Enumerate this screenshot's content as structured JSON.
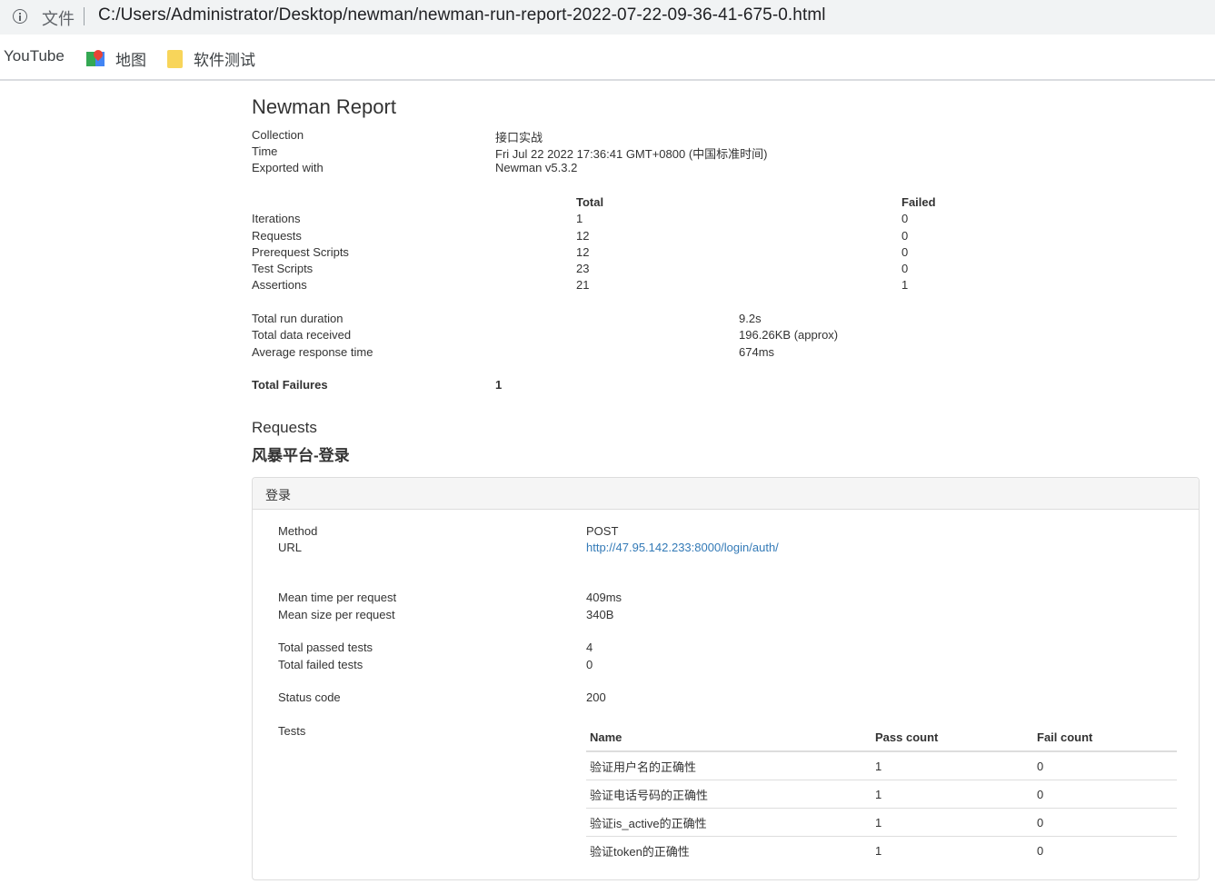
{
  "browser": {
    "protocol_label": "文件",
    "url": "C:/Users/Administrator/Desktop/newman/newman-run-report-2022-07-22-09-36-41-675-0.html",
    "bookmarks": [
      {
        "label": "YouTube"
      },
      {
        "label": "地图"
      },
      {
        "label": "软件测试"
      }
    ]
  },
  "report": {
    "title": "Newman Report",
    "meta": [
      {
        "label": "Collection",
        "value": "接口实战"
      },
      {
        "label": "Time",
        "value": "Fri Jul 22 2022 17:36:41 GMT+0800 (中国标准时间)"
      },
      {
        "label": "Exported with",
        "value": "Newman v5.3.2"
      }
    ],
    "summary_headers": {
      "total": "Total",
      "failed": "Failed"
    },
    "summary": [
      {
        "label": "Iterations",
        "total": "1",
        "failed": "0"
      },
      {
        "label": "Requests",
        "total": "12",
        "failed": "0"
      },
      {
        "label": "Prerequest Scripts",
        "total": "12",
        "failed": "0"
      },
      {
        "label": "Test Scripts",
        "total": "23",
        "failed": "0"
      },
      {
        "label": "Assertions",
        "total": "21",
        "failed": "1"
      }
    ],
    "timings": [
      {
        "label": "Total run duration",
        "value": "9.2s"
      },
      {
        "label": "Total data received",
        "value": "196.26KB (approx)"
      },
      {
        "label": "Average response time",
        "value": "674ms"
      }
    ],
    "total_failures": {
      "label": "Total Failures",
      "value": "1"
    },
    "requests_heading": "Requests",
    "folder_name": "风暴平台-登录",
    "request": {
      "name": "登录",
      "method_label": "Method",
      "method": "POST",
      "url_label": "URL",
      "url": "http://47.95.142.233:8000/login/auth/",
      "mean_time_label": "Mean time per request",
      "mean_time": "409ms",
      "mean_size_label": "Mean size per request",
      "mean_size": "340B",
      "passed_label": "Total passed tests",
      "passed": "4",
      "failed_label": "Total failed tests",
      "failed": "0",
      "status_label": "Status code",
      "status": "200",
      "tests_label": "Tests",
      "tests_headers": {
        "name": "Name",
        "pass": "Pass count",
        "fail": "Fail count"
      },
      "tests": [
        {
          "name": "验证用户名的正确性",
          "pass": "1",
          "fail": "0"
        },
        {
          "name": "验证电话号码的正确性",
          "pass": "1",
          "fail": "0"
        },
        {
          "name": "验证is_active的正确性",
          "pass": "1",
          "fail": "0"
        },
        {
          "name": "验证token的正确性",
          "pass": "1",
          "fail": "0"
        }
      ]
    }
  }
}
